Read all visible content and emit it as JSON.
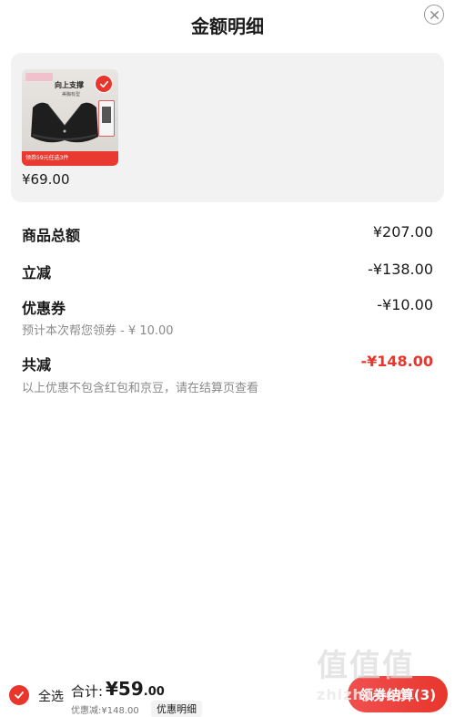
{
  "header": {
    "title": "金额明细"
  },
  "product": {
    "price": "¥69.00",
    "thumbnail": {
      "headline": "向上支撑",
      "subline": "美胸有型",
      "banner": "领券59元任选3件"
    }
  },
  "summary": {
    "total_label": "商品总额",
    "total_value": "¥207.00",
    "instant_label": "立减",
    "instant_value": "-¥138.00",
    "coupon_label": "优惠券",
    "coupon_value": "-¥10.00",
    "coupon_note": "预计本次帮您领券 - ¥ 10.00",
    "combined_label": "共减",
    "combined_value": "-¥148.00",
    "disclaimer": "以上优惠不包含红包和京豆，请在结算页查看"
  },
  "bottom_bar": {
    "select_all": "全选",
    "total_label": "合计:",
    "total_currency": "¥",
    "total_integer": "59",
    "total_cents": ".00",
    "discount_text": "优惠减:¥148.00",
    "detail_link": "优惠明细",
    "checkout_label": "领券结算(3)"
  },
  "watermark": {
    "glyphs": "值值值",
    "domain": "zhizhi.com"
  },
  "colors": {
    "accent": "#e8362c",
    "card_bg": "#f2f2f2",
    "muted_text": "#8a8a8a"
  },
  "icons": [
    "close-icon",
    "check-icon"
  ]
}
